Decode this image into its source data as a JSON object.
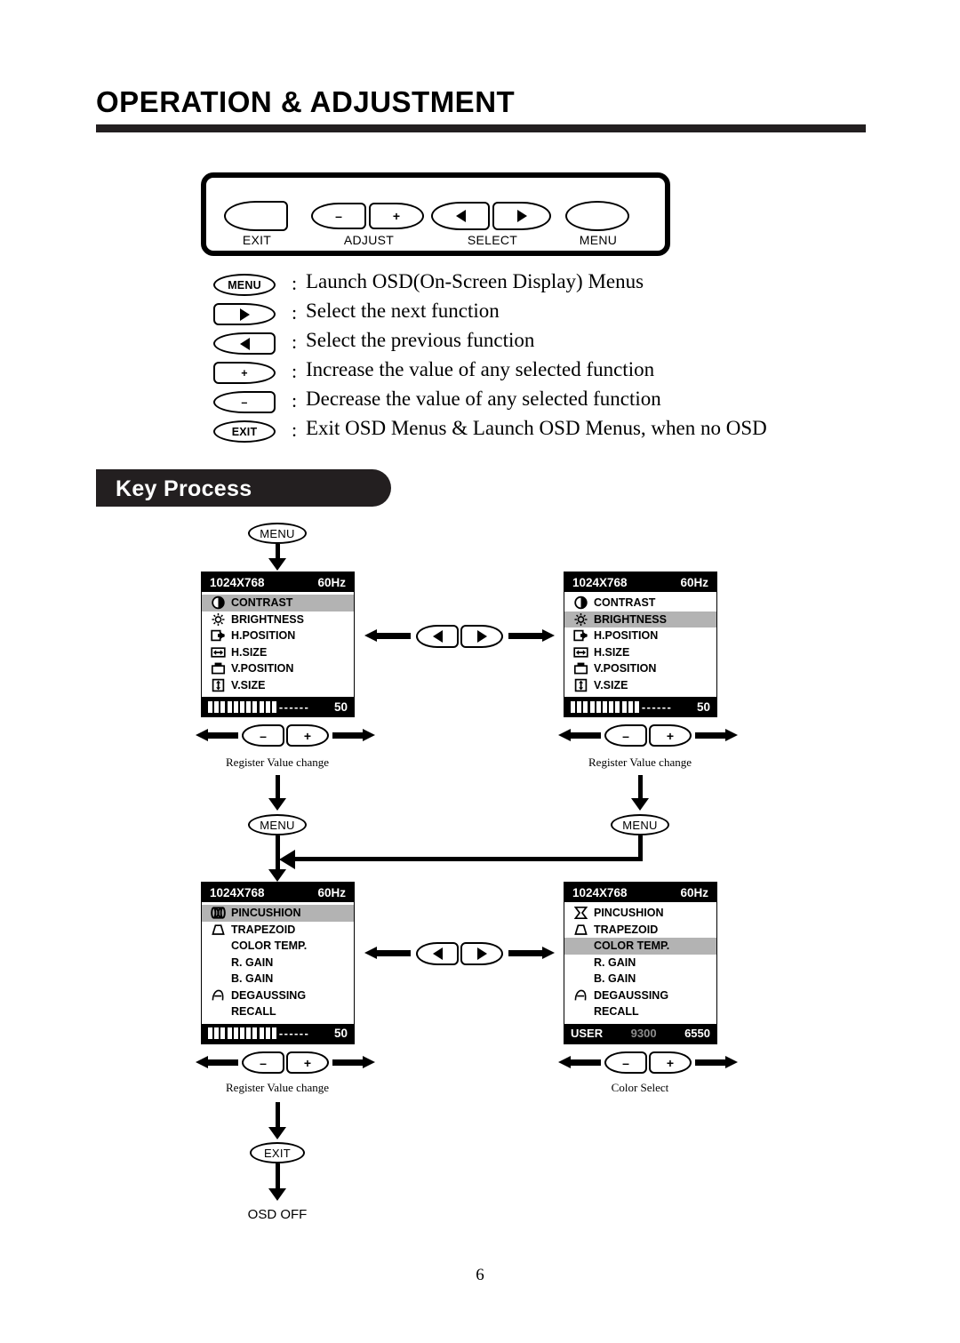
{
  "page": {
    "title": "OPERATION & ADJUSTMENT",
    "number": "6"
  },
  "control_panel": {
    "buttons": [
      {
        "glyph": "",
        "label": "EXIT",
        "icon": "blank-oval-button"
      },
      {
        "glyph": "–",
        "label": "ADJUST",
        "icon": "minus-button"
      },
      {
        "glyph": "+",
        "label": "",
        "icon": "plus-button"
      },
      {
        "glyph": "◀",
        "label": "SELECT",
        "icon": "left-arrow-button"
      },
      {
        "glyph": "▶",
        "label": "",
        "icon": "right-arrow-button"
      },
      {
        "glyph": "",
        "label": "MENU",
        "icon": "blank-oval-button"
      }
    ],
    "labels": [
      "EXIT",
      "ADJUST",
      "SELECT",
      "MENU"
    ]
  },
  "legend": {
    "colon": ":",
    "rows": [
      {
        "key": "MENU",
        "key_type": "text",
        "desc": "Launch OSD(On-Screen Display) Menus"
      },
      {
        "key": "▶",
        "key_type": "glyph",
        "desc": "Select the next function"
      },
      {
        "key": "◀",
        "key_type": "glyph",
        "desc": "Select the previous function"
      },
      {
        "key": "+",
        "key_type": "glyph",
        "desc": "Increase the value of any selected function"
      },
      {
        "key": "–",
        "key_type": "glyph",
        "desc": "Decrease the value of any selected function"
      },
      {
        "key": "EXIT",
        "key_type": "text",
        "desc": "Exit OSD Menus & Launch OSD Menus, when no OSD"
      }
    ]
  },
  "banner": {
    "label": "Key Process"
  },
  "flow": {
    "start_menu": "MENU",
    "menu_mid_left": "MENU",
    "menu_mid_right": "MENU",
    "exit_node": "EXIT",
    "osd_off": "OSD OFF",
    "captions": {
      "reg_tl": "Register Value change",
      "reg_tr": "Register Value change",
      "reg_bl": "Register Value change",
      "color_select": "Color Select"
    },
    "select_buttons": {
      "prev": "◀",
      "next": "▶"
    },
    "adjust_buttons": {
      "minus": "–",
      "plus": "+"
    }
  },
  "osd_panels": [
    {
      "id": "panel-contrast",
      "resolution": "1024X768",
      "refresh": "60Hz",
      "items": [
        {
          "label": "CONTRAST",
          "icon": "contrast-icon",
          "highlight": true
        },
        {
          "label": "BRIGHTNESS",
          "icon": "brightness-icon",
          "highlight": false
        },
        {
          "label": "H.POSITION",
          "icon": "h-position-icon",
          "highlight": false
        },
        {
          "label": "H.SIZE",
          "icon": "h-size-icon",
          "highlight": false
        },
        {
          "label": "V.POSITION",
          "icon": "v-position-icon",
          "highlight": false
        },
        {
          "label": "V.SIZE",
          "icon": "v-size-icon",
          "highlight": false
        }
      ],
      "footer": {
        "type": "slider",
        "filled": 11,
        "dashes": "------",
        "value": "50"
      }
    },
    {
      "id": "panel-brightness",
      "resolution": "1024X768",
      "refresh": "60Hz",
      "items": [
        {
          "label": "CONTRAST",
          "icon": "contrast-icon",
          "highlight": false
        },
        {
          "label": "BRIGHTNESS",
          "icon": "brightness-icon",
          "highlight": true
        },
        {
          "label": "H.POSITION",
          "icon": "h-position-icon",
          "highlight": false
        },
        {
          "label": "H.SIZE",
          "icon": "h-size-icon",
          "highlight": false
        },
        {
          "label": "V.POSITION",
          "icon": "v-position-icon",
          "highlight": false
        },
        {
          "label": "V.SIZE",
          "icon": "v-size-icon",
          "highlight": false
        }
      ],
      "footer": {
        "type": "slider",
        "filled": 11,
        "dashes": "------",
        "value": "50"
      }
    },
    {
      "id": "panel-pincushion",
      "resolution": "1024X768",
      "refresh": "60Hz",
      "items": [
        {
          "label": "PINCUSHION",
          "icon": "barrel-icon",
          "highlight": true
        },
        {
          "label": "TRAPEZOID",
          "icon": "trapezoid-icon",
          "highlight": false
        },
        {
          "label": "COLOR TEMP.",
          "icon": "none",
          "highlight": false
        },
        {
          "label": "R. GAIN",
          "icon": "none",
          "highlight": false
        },
        {
          "label": "B. GAIN",
          "icon": "none",
          "highlight": false
        },
        {
          "label": "DEGAUSSING",
          "icon": "degauss-icon",
          "highlight": false
        },
        {
          "label": "RECALL",
          "icon": "none",
          "highlight": false
        }
      ],
      "footer": {
        "type": "slider",
        "filled": 11,
        "dashes": "------",
        "value": "50"
      }
    },
    {
      "id": "panel-color-temp",
      "resolution": "1024X768",
      "refresh": "60Hz",
      "items": [
        {
          "label": "PINCUSHION",
          "icon": "pincushion-icon",
          "highlight": false
        },
        {
          "label": "TRAPEZOID",
          "icon": "trapezoid-icon",
          "highlight": false
        },
        {
          "label": "COLOR TEMP.",
          "icon": "none",
          "highlight": true
        },
        {
          "label": "R. GAIN",
          "icon": "none",
          "highlight": false
        },
        {
          "label": "B. GAIN",
          "icon": "none",
          "highlight": false
        },
        {
          "label": "DEGAUSSING",
          "icon": "degauss-icon",
          "highlight": false
        },
        {
          "label": "RECALL",
          "icon": "none",
          "highlight": false
        }
      ],
      "footer": {
        "type": "color",
        "options": [
          "USER",
          "9300",
          "6550"
        ]
      }
    }
  ]
}
